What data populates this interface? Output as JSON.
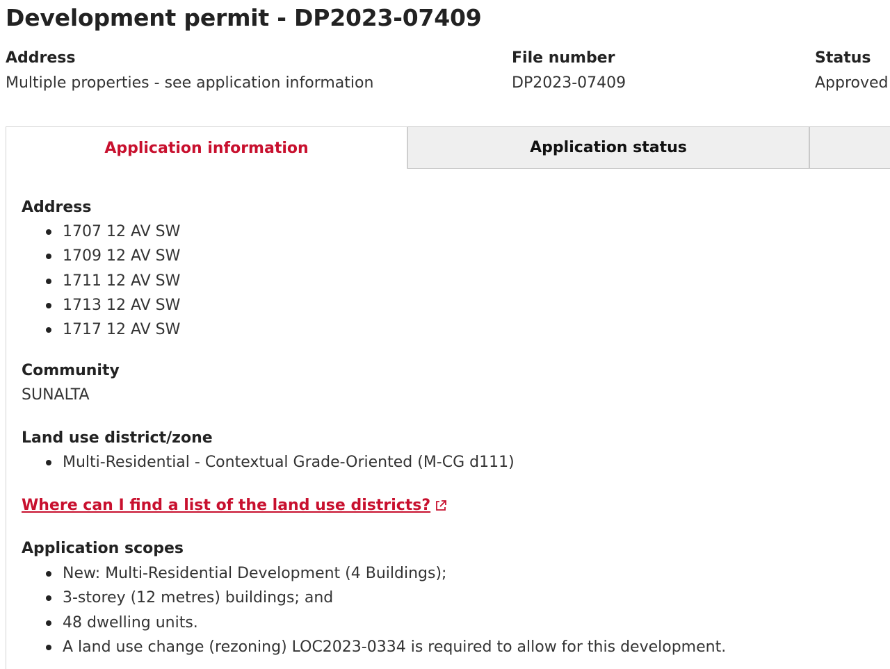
{
  "page": {
    "title": "Development permit - DP2023-07409"
  },
  "summary": {
    "address_label": "Address",
    "address_value": "Multiple properties - see application information",
    "file_number_label": "File number",
    "file_number_value": "DP2023-07409",
    "status_label": "Status",
    "status_value": "Approved"
  },
  "tabs": [
    {
      "label": "Application information",
      "active": true
    },
    {
      "label": "Application status",
      "active": false
    }
  ],
  "details": {
    "address_label": "Address",
    "addresses": [
      "1707 12 AV SW",
      "1709 12 AV SW",
      "1711 12 AV SW",
      "1713 12 AV SW",
      "1717 12 AV SW"
    ],
    "community_label": "Community",
    "community_value": "SUNALTA",
    "land_use_label": "Land use district/zone",
    "land_use_items": [
      "Multi-Residential - Contextual Grade-Oriented (M-CG d111)"
    ],
    "land_use_link": "Where can I find a list of the land use districts?",
    "scopes_label": "Application scopes",
    "scopes": [
      "New: Multi-Residential Development (4 Buildings);",
      "3-storey (12 metres) buildings; and",
      "48 dwelling units.",
      "A land use change (rezoning) LOC2023-0334 is required to allow for this development."
    ]
  },
  "colors": {
    "accent": "#c8102e",
    "tab_inactive_bg": "#efefef",
    "text": "#333333"
  },
  "icons": {
    "external_link": "external-link-icon"
  }
}
